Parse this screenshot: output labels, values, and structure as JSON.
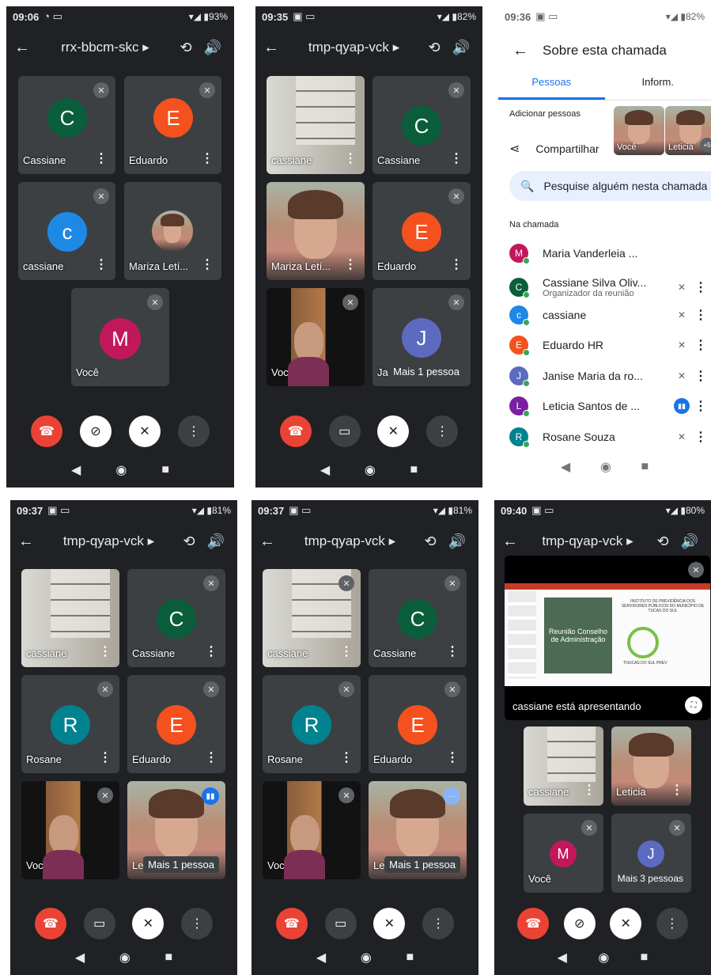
{
  "screens": [
    {
      "time": "09:06",
      "battery": "93%",
      "meeting": "rrx-bbcm-skc",
      "tiles": [
        {
          "name": "Cassiane",
          "initial": "C",
          "color": "#0b5e3b"
        },
        {
          "name": "Eduardo",
          "initial": "E",
          "color": "#f4511e"
        },
        {
          "name": "cassiane",
          "initial": "c",
          "color": "#1e88e5"
        },
        {
          "name": "Mariza Letí...",
          "initial": "",
          "color": ""
        },
        {
          "name": "Você",
          "initial": "M",
          "color": "#c2185b"
        }
      ]
    },
    {
      "time": "09:35",
      "battery": "82%",
      "meeting": "tmp-qyap-vck",
      "tiles": [
        {
          "name": "cassiane"
        },
        {
          "name": "Cassiane",
          "initial": "C",
          "color": "#0b5e3b"
        },
        {
          "name": "Mariza Letí..."
        },
        {
          "name": "Eduardo",
          "initial": "E",
          "color": "#f4511e"
        },
        {
          "name": "Você"
        },
        {
          "name": "Ja",
          "initial": "J",
          "color": "#5c6bc0",
          "more": "Mais 1 pessoa"
        }
      ]
    },
    {
      "time": "09:36",
      "battery": "82%",
      "header": "Sobre esta chamada",
      "tabs": [
        "Pessoas",
        "Inform."
      ],
      "add_people": "Adicionar pessoas",
      "share": "Compartilhar",
      "mini_you": "Você",
      "mini_other": "Leticia",
      "mini_badge": "+5",
      "search_placeholder": "Pesquise alguém nesta chamada",
      "in_call": "Na chamada",
      "people": [
        {
          "name": "Maria Vanderleia ...",
          "initial": "M",
          "color": "#c2185b",
          "sub": ""
        },
        {
          "name": "Cassiane Silva Oliv...",
          "initial": "C",
          "color": "#0b5e3b",
          "sub": "Organizador da reunião"
        },
        {
          "name": "cassiane",
          "initial": "c",
          "color": "#1e88e5",
          "sub": ""
        },
        {
          "name": "Eduardo HR",
          "initial": "E",
          "color": "#f4511e",
          "sub": ""
        },
        {
          "name": "Janise Maria da ro...",
          "initial": "J",
          "color": "#5c6bc0",
          "sub": ""
        },
        {
          "name": "Leticia Santos de ...",
          "initial": "L",
          "color": "#7b1fa2",
          "sub": ""
        },
        {
          "name": "Rosane Souza",
          "initial": "R",
          "color": "#00838f",
          "sub": ""
        }
      ]
    },
    {
      "time": "09:37",
      "battery": "81%",
      "meeting": "tmp-qyap-vck",
      "tiles": [
        {
          "name": "cassiane"
        },
        {
          "name": "Cassiane",
          "initial": "C",
          "color": "#0b5e3b"
        },
        {
          "name": "Rosane",
          "initial": "R",
          "color": "#00838f"
        },
        {
          "name": "Eduardo",
          "initial": "E",
          "color": "#f4511e"
        },
        {
          "name": "Você"
        },
        {
          "name": "Le",
          "more": "Mais 1 pessoa"
        }
      ]
    },
    {
      "time": "09:37",
      "battery": "81%",
      "meeting": "tmp-qyap-vck",
      "tiles": [
        {
          "name": "cassiane"
        },
        {
          "name": "Cassiane",
          "initial": "C",
          "color": "#0b5e3b"
        },
        {
          "name": "Rosane",
          "initial": "R",
          "color": "#00838f"
        },
        {
          "name": "Eduardo",
          "initial": "E",
          "color": "#f4511e"
        },
        {
          "name": "Você"
        },
        {
          "name": "Le",
          "more": "Mais 1 pessoa"
        }
      ]
    },
    {
      "time": "09:40",
      "battery": "80%",
      "meeting": "tmp-qyap-vck",
      "presenting": "cassiane está apresentando",
      "slide_title": "Reunião Conselho de Administração",
      "slide_header": "INSTITUTO DE PREVIDÊNCIA DOS SERVIDORES PÚBLICOS DO MUNICÍPIO DE TUCAS DO SUL",
      "slide_logo_text": "TOUCAS DO SUL PREV",
      "tiles": [
        {
          "name": "cassiane"
        },
        {
          "name": "Leticia"
        },
        {
          "name": "Você",
          "initial": "M",
          "color": "#c2185b"
        },
        {
          "name": "",
          "initial": "J",
          "color": "#5c6bc0",
          "more": "Mais 3 pessoas"
        }
      ]
    }
  ]
}
